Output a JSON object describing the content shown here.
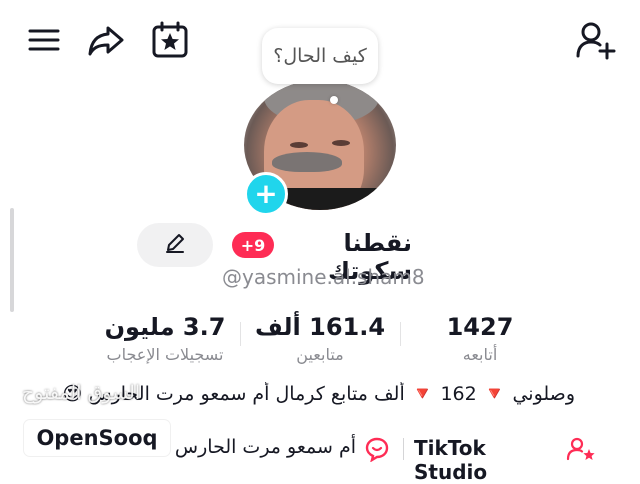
{
  "header": {
    "icons": [
      "menu-icon",
      "share-icon",
      "calendar-star-icon",
      "add-user-icon"
    ]
  },
  "profile": {
    "bubble_text": "كيف الحال؟",
    "display_name": "نقطنا سكوتك",
    "notification_badge": "+9",
    "username": "@yasmine.al.sham8",
    "edit_icon": "pencil-icon"
  },
  "stats": {
    "following_value": "1427",
    "following_label": "أتابعه",
    "followers_value": "161.4 ألف",
    "followers_label": "متابعين",
    "likes_value": "3.7 مليون",
    "likes_label": "تسجيلات الإعجاب"
  },
  "bio": {
    "line1": "وصلوني 🔻 162 🔻 ألف متابع كرمال أم سمعو مرت الحارس 😍",
    "line2": "أم سمعو مرت الحارس",
    "studio_label": "TikTok Studio"
  },
  "watermark": {
    "arabic": "السوق المفتوح",
    "brand": "OpenSooq"
  },
  "colors": {
    "accent_pink": "#fe2c55",
    "plus_cyan": "#20d5ec",
    "muted_text": "#8a8b91"
  }
}
